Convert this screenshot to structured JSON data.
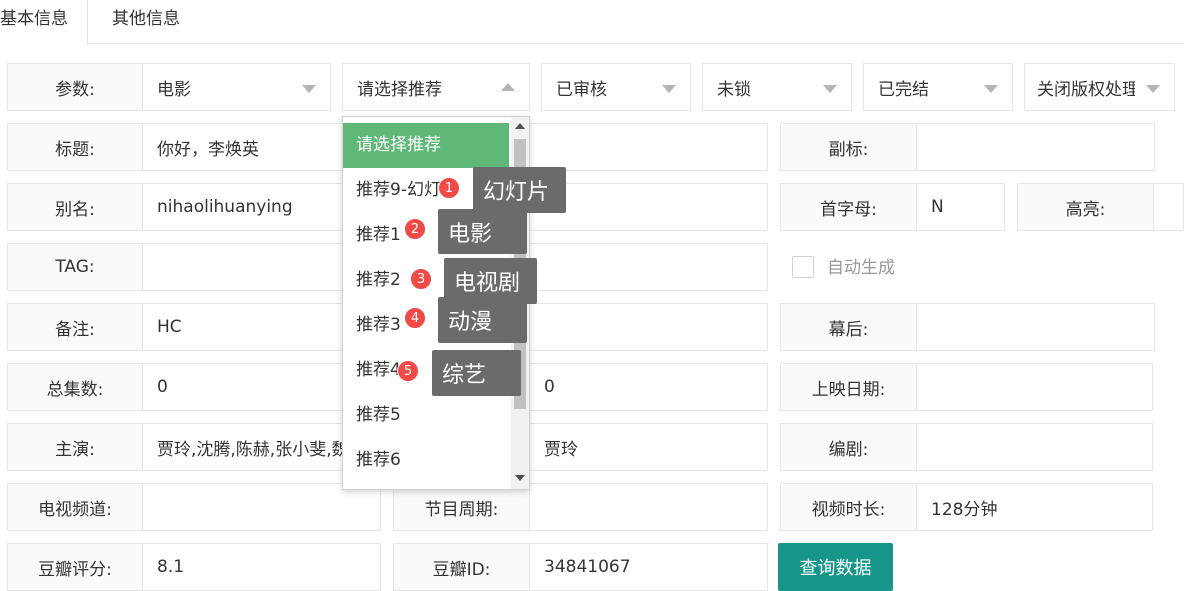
{
  "tabs": [
    "基本信息",
    "其他信息"
  ],
  "form": {
    "params_label": "参数:",
    "params_value": "电影",
    "recommend_placeholder": "请选择推荐",
    "review_value": "已审核",
    "lock_value": "未锁",
    "finish_value": "已完结",
    "copyright_value": "关闭版权处理",
    "title_label": "标题:",
    "title_value": "你好，李焕英",
    "subtitle_label": "副标:",
    "alias_label": "别名:",
    "alias_value": "nihaolihuanying",
    "initial_label": "首字母:",
    "initial_value": "N",
    "highlight_label": "高亮:",
    "tag_label": "TAG:",
    "auto_generate_label": "自动生成",
    "note_label": "备注:",
    "note_value": "HC",
    "behind_label": "幕后:",
    "episodes_label": "总集数:",
    "episodes_value": "0",
    "middle_value_row6": "0",
    "release_label": "上映日期:",
    "cast_label": "主演:",
    "cast_value": "贾玲,沈腾,陈赫,张小斐,魏",
    "director_value": "贾玲",
    "writer_label": "编剧:",
    "channel_label": "电视频道:",
    "period_label": "节目周期:",
    "duration_label": "视频时长:",
    "duration_value": "128分钟",
    "douban_score_label": "豆瓣评分:",
    "douban_score_value": "8.1",
    "douban_id_label": "豆瓣ID:",
    "douban_id_value": "34841067",
    "query_button": "查询数据"
  },
  "dropdown": {
    "items": [
      "请选择推荐",
      "推荐9-幻灯片",
      "推荐1",
      "推荐2",
      "推荐3",
      "推荐4",
      "推荐5",
      "推荐6"
    ],
    "selected_index": 0
  },
  "annotations": [
    {
      "num": "1",
      "text": "幻灯片"
    },
    {
      "num": "2",
      "text": "电影"
    },
    {
      "num": "3",
      "text": "电视剧"
    },
    {
      "num": "4",
      "text": "动漫"
    },
    {
      "num": "5",
      "text": "综艺"
    }
  ],
  "colors": {
    "selected_green": "#5fb878",
    "button_teal": "#169688",
    "badge_red": "#f24a47",
    "tooltip_gray": "#6b6b6b"
  }
}
